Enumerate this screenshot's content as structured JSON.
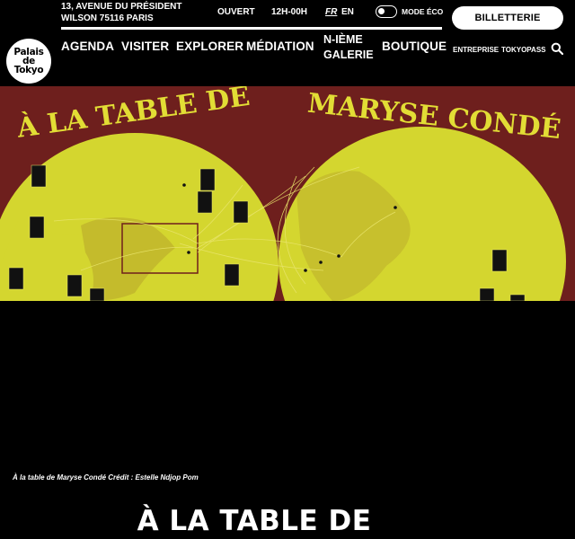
{
  "header": {
    "logo": {
      "line1": "Palais",
      "line2": "de",
      "line3": "Tokyo"
    },
    "address": "13, AVENUE DU PRÉSIDENT WILSON 75116 PARIS",
    "status": "OUVERT",
    "hours": "12H-00H",
    "lang_fr": "FR",
    "lang_en": "EN",
    "eco_mode": "MODE ÉCO",
    "ticket": "BILLETTERIE",
    "nav": {
      "agenda": "AGENDA",
      "visiter": "VISITER",
      "explorer": "EXPLORER",
      "mediation": "MÉDIATION",
      "galerie_line1": "N-IÈME",
      "galerie_line2": "GALERIE",
      "boutique": "BOUTIQUE",
      "entreprise": "ENTREPRISE",
      "tokyopass": "TOKYOPASS"
    }
  },
  "hero": {
    "banner_left": "À LA TABLE DE",
    "banner_right": "MARYSE CONDÉ",
    "colors": {
      "background": "#6e1f1d",
      "land": "#d4d62f",
      "text": "#e2dd35"
    }
  },
  "caption": "À la table de Maryse Condé Crédit : Estelle Ndjop Pom",
  "title": "À LA TABLE DE"
}
